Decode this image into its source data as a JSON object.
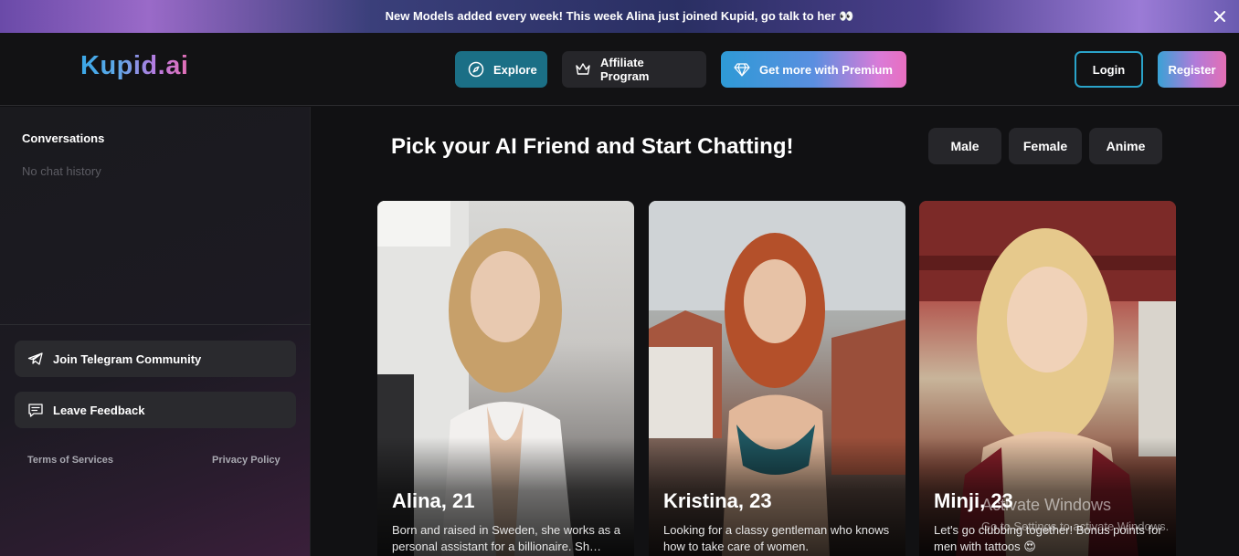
{
  "banner": {
    "text": "New Models added every week! This week Alina just joined Kupid, go talk to her 👀",
    "close_icon": "close-icon"
  },
  "header": {
    "logo": "Kupid.ai",
    "nav": {
      "explore": "Explore",
      "affiliate": "Affiliate Program",
      "premium": "Get more with Premium"
    },
    "login": "Login",
    "register": "Register"
  },
  "sidebar": {
    "title": "Conversations",
    "empty": "No chat history",
    "telegram": "Join Telegram Community",
    "feedback": "Leave Feedback",
    "terms": "Terms of Services",
    "privacy": "Privacy Policy"
  },
  "main": {
    "title": "Pick your AI Friend and Start Chatting!",
    "filters": [
      "Male",
      "Female",
      "Anime"
    ],
    "cards": [
      {
        "name": "Alina, 21",
        "desc": "Born and raised in Sweden, she works as a personal assistant for a billionaire. Sh…"
      },
      {
        "name": "Kristina, 23",
        "desc": "Looking for a classy gentleman who knows how to take care of women."
      },
      {
        "name": "Minji, 23",
        "desc": "Let's go clubbing together! Bonus points for men with tattoos 😍"
      }
    ]
  },
  "watermark": {
    "title": "Activate Windows",
    "subtitle": "Go to Settings to activate Windows."
  },
  "colors": {
    "accent_teal": "#1b6f86",
    "login_border": "#2aa3c9",
    "page_bg": "#111113"
  }
}
